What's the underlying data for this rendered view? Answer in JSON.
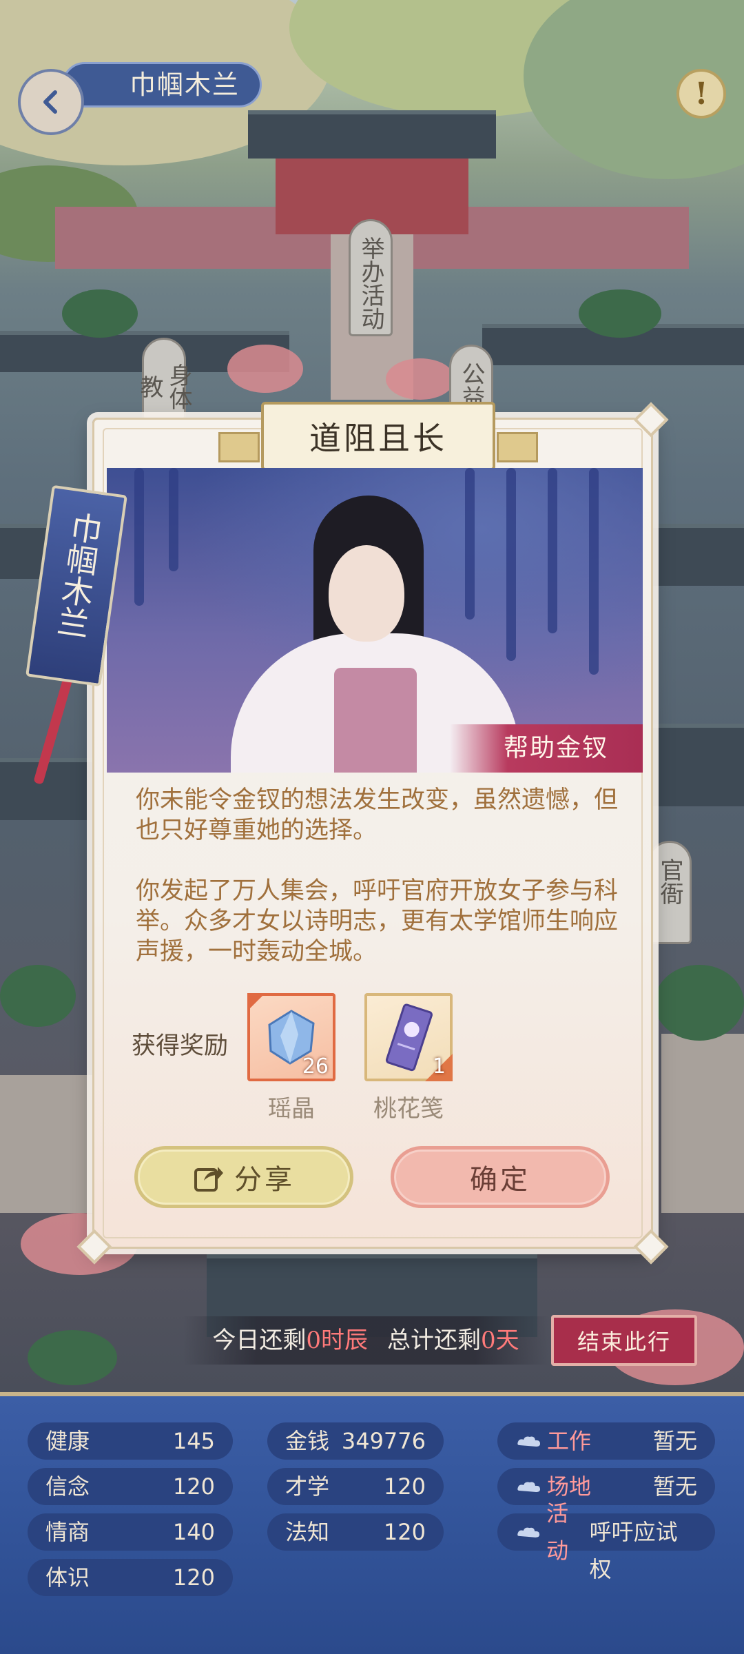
{
  "header": {
    "title": "巾帼木兰",
    "info_icon": "exclamation-icon",
    "back_icon": "chevron-left-icon"
  },
  "map": {
    "tags": [
      "举办活动",
      "身体教",
      "公益",
      "官衙"
    ]
  },
  "dialog": {
    "title": "道阻且长",
    "bookmark": "巾帼木兰",
    "portrait_tag": "帮助金钗",
    "story": [
      "你未能令金钗的想法发生改变，虽然遗憾，但也只好尊重她的选择。",
      "你发起了万人集会，呼吁官府开放女子参与科举。众多才女以诗明志，更有太学馆师生响应声援，一时轰动全城。"
    ],
    "reward_label": "获得奖励",
    "rewards": [
      {
        "name": "瑶晶",
        "count": "26",
        "icon": "crystal-icon"
      },
      {
        "name": "桃花笺",
        "count": "1",
        "icon": "letter-icon"
      }
    ],
    "share_label": "分享",
    "confirm_label": "确定"
  },
  "timebar": {
    "today_prefix": "今日还剩",
    "today_value": "0时辰",
    "total_prefix": "总计还剩",
    "total_value": "0天",
    "end_label": "结束此行"
  },
  "stats": {
    "col1": [
      {
        "label": "健康",
        "value": "145"
      },
      {
        "label": "信念",
        "value": "120"
      },
      {
        "label": "情商",
        "value": "140"
      },
      {
        "label": "体识",
        "value": "120"
      }
    ],
    "col2": [
      {
        "label": "金钱",
        "value": "349776"
      },
      {
        "label": "才学",
        "value": "120"
      },
      {
        "label": "法知",
        "value": "120"
      }
    ],
    "col3": [
      {
        "label": "工作",
        "value": "暂无"
      },
      {
        "label": "场地",
        "value": "暂无"
      },
      {
        "label": "活动",
        "value": "呼吁应试权"
      }
    ]
  },
  "colors": {
    "accent_red": "#a82e4b",
    "panel_blue": "#34569c",
    "highlight": "#ff7a7a"
  }
}
